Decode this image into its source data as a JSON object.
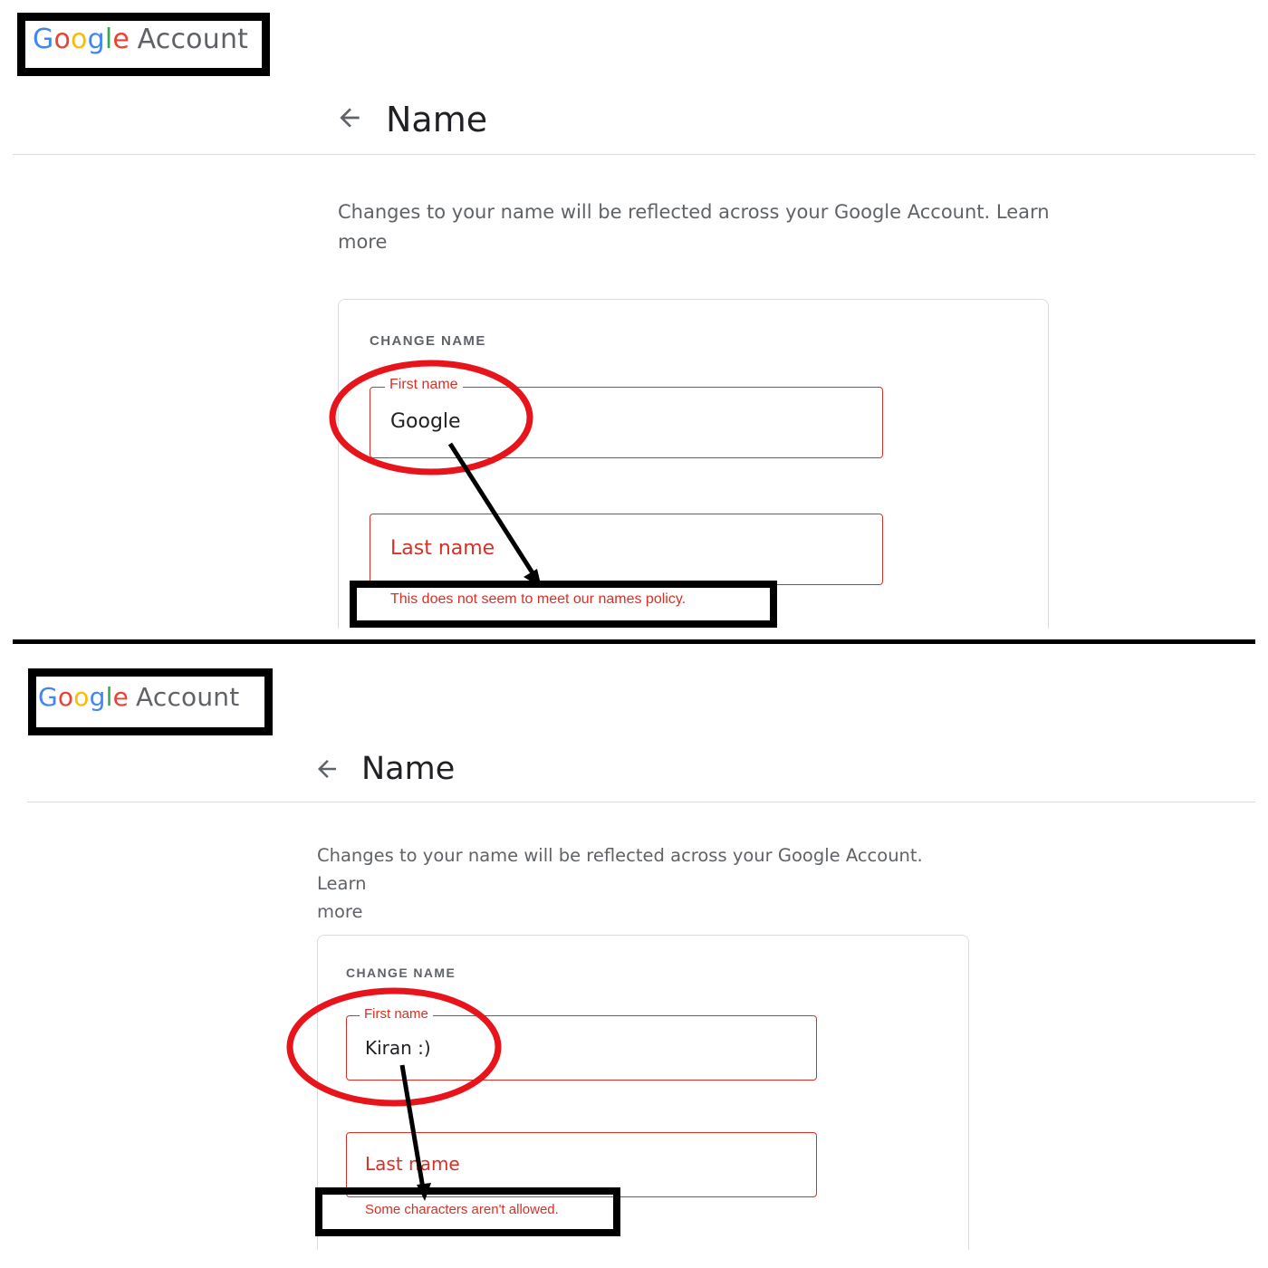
{
  "panels": [
    {
      "logo": {
        "brand_letters": [
          "G",
          "o",
          "o",
          "g",
          "l",
          "e"
        ],
        "product": "Account"
      },
      "header": {
        "title": "Name"
      },
      "description": {
        "text": "Changes to your name will be reflected across your Google Account.",
        "link": "Learn",
        "link_cont": "more"
      },
      "card": {
        "section_label": "CHANGE NAME",
        "first_name": {
          "label": "First name",
          "value": "Google"
        },
        "last_name": {
          "placeholder": "Last name"
        },
        "error": "This does not seem to meet our names policy."
      }
    },
    {
      "logo": {
        "brand_letters": [
          "G",
          "o",
          "o",
          "g",
          "l",
          "e"
        ],
        "product": "Account"
      },
      "header": {
        "title": "Name"
      },
      "description": {
        "text": "Changes to your name will be reflected across your Google Account.",
        "link": "Learn",
        "link_cont": "more"
      },
      "card": {
        "section_label": "CHANGE NAME",
        "first_name": {
          "label": "First name",
          "value": "Kiran :)"
        },
        "last_name": {
          "placeholder": "Last name"
        },
        "error": "Some characters aren't allowed."
      }
    }
  ],
  "colors": {
    "google_blue": "#4285f4",
    "google_red": "#ea4335",
    "google_yellow": "#fbbc05",
    "google_green": "#34a853",
    "error_red": "#d93025",
    "annotation_red": "#e8141c",
    "annotation_black": "#000000"
  },
  "icons": {
    "back": "arrow-left-icon"
  }
}
